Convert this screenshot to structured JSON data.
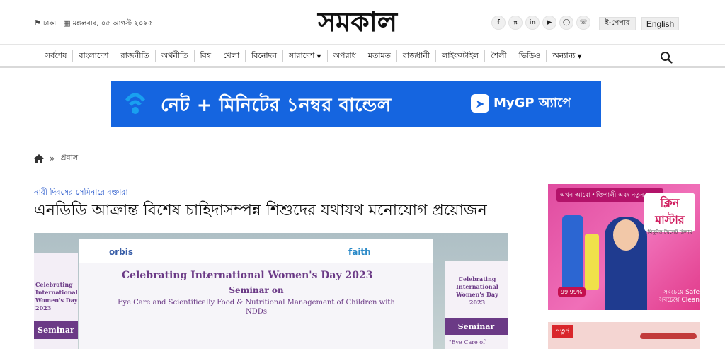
{
  "header": {
    "location": "ঢাকা",
    "date": "মঙ্গলবার, ০৫ আগস্ট ২০২৫",
    "logo_text": "সমকাল",
    "epaper_label": "ই-পেপার",
    "english_label": "English",
    "social_icons": [
      "facebook-icon",
      "twitter-icon",
      "linkedin-icon",
      "youtube-icon",
      "instagram-icon",
      "whatsapp-icon"
    ]
  },
  "nav": {
    "items": [
      {
        "label": "সর্বশেষ"
      },
      {
        "label": "বাংলাদেশ"
      },
      {
        "label": "রাজনীতি"
      },
      {
        "label": "অর্থনীতি"
      },
      {
        "label": "বিশ্ব"
      },
      {
        "label": "খেলা"
      },
      {
        "label": "বিনোদন"
      },
      {
        "label": "সারাদেশ"
      },
      {
        "label": "অপরাধ"
      },
      {
        "label": "মতামত"
      },
      {
        "label": "রাজধানী"
      },
      {
        "label": "লাইফস্টাইল"
      },
      {
        "label": "শৈলী"
      },
      {
        "label": "ভিডিও"
      },
      {
        "label": "অন্যান্য"
      }
    ]
  },
  "banner_ad": {
    "text": "নেট + মিনিটের ১নম্বর বান্ডেল",
    "cta": "MyGP অ্যাপে",
    "bg_color": "#1565e0"
  },
  "breadcrumb": {
    "section": "প্রবাস"
  },
  "article": {
    "shoulder": "নারী দিবসের সেমিনারে বক্তারা",
    "headline": "এনডিডি আক্রান্ত বিশেষ চাহিদাসম্পন্ন শিশুদের যথাযথ মনোযোগ প্রয়োজন",
    "image": {
      "logos": [
        "orbis",
        "faith"
      ],
      "title": "Celebrating International Women's Day 2023",
      "subtitle": "Seminar on",
      "topic": "Eye Care and Scientifically Food & Nutritional Management of Children with NDDs",
      "left_panel_text": "Celebrating International Women's Day 2023",
      "left_panel_label": "Seminar",
      "right_panel_text": "Celebrating International Women's Day 2023",
      "right_panel_label": "Seminar",
      "right_panel_quote": "\"Eye Care of"
    }
  },
  "side_ad_1": {
    "tag": "এখন আরো শক্তিশালী এবং নতুন সাজে",
    "brand": "ক্লিন মাস্টার",
    "brand_sub": "লিকুইড টয়লেট ক্লিনার",
    "percent": "99.99%",
    "safe_text": "সবচেয়ে Safe সবচেয়ে Clean"
  },
  "side_ad_2": {
    "tag": "নতুন"
  }
}
